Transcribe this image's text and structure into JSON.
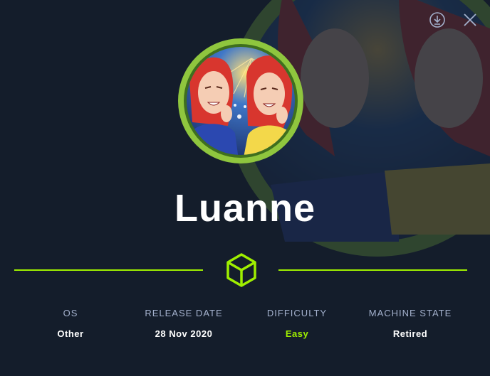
{
  "machine": {
    "name": "Luanne"
  },
  "icons": {
    "download": "download-icon",
    "close": "close-icon",
    "cube": "cube-icon"
  },
  "colors": {
    "background": "#141d2b",
    "accent": "#9fef00",
    "label": "#a4b1cd",
    "value": "#ffffff"
  },
  "stats": [
    {
      "label": "OS",
      "value": "Other"
    },
    {
      "label": "RELEASE DATE",
      "value": "28 Nov 2020"
    },
    {
      "label": "DIFFICULTY",
      "value": "Easy"
    },
    {
      "label": "MACHINE STATE",
      "value": "Retired"
    }
  ]
}
